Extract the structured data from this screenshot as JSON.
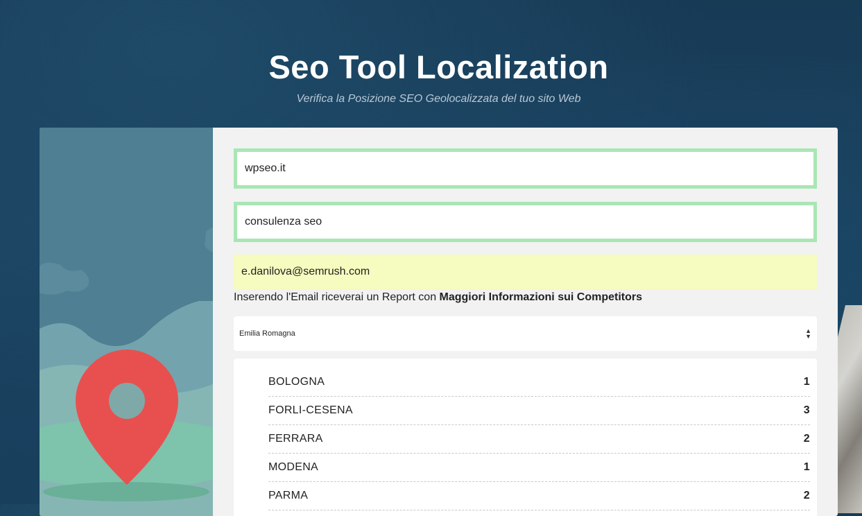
{
  "header": {
    "title": "Seo Tool Localization",
    "subtitle": "Verifica la Posizione SEO Geolocalizzata del tuo sito Web"
  },
  "form": {
    "site_value": "wpseo.it",
    "keyword_value": "consulenza seo",
    "email_value": "e.danilova@semrush.com",
    "email_hint_prefix": "Inserendo l'Email riceverai un Report con ",
    "email_hint_bold": "Maggiori Informazioni sui Competitors",
    "region_selected": "Emilia Romagna"
  },
  "results": [
    {
      "city": "BOLOGNA",
      "position": "1"
    },
    {
      "city": "FORLI-CESENA",
      "position": "3"
    },
    {
      "city": "FERRARA",
      "position": "2"
    },
    {
      "city": "MODENA",
      "position": "1"
    },
    {
      "city": "PARMA",
      "position": "2"
    }
  ],
  "colors": {
    "field_border": "#a9e6b4",
    "email_bg": "#f6fbbf",
    "pin": "#e85050",
    "panel": "#4e7f92"
  },
  "icons": {
    "map_pin": "map-pin-icon",
    "select_arrows": "select-arrows-icon"
  }
}
